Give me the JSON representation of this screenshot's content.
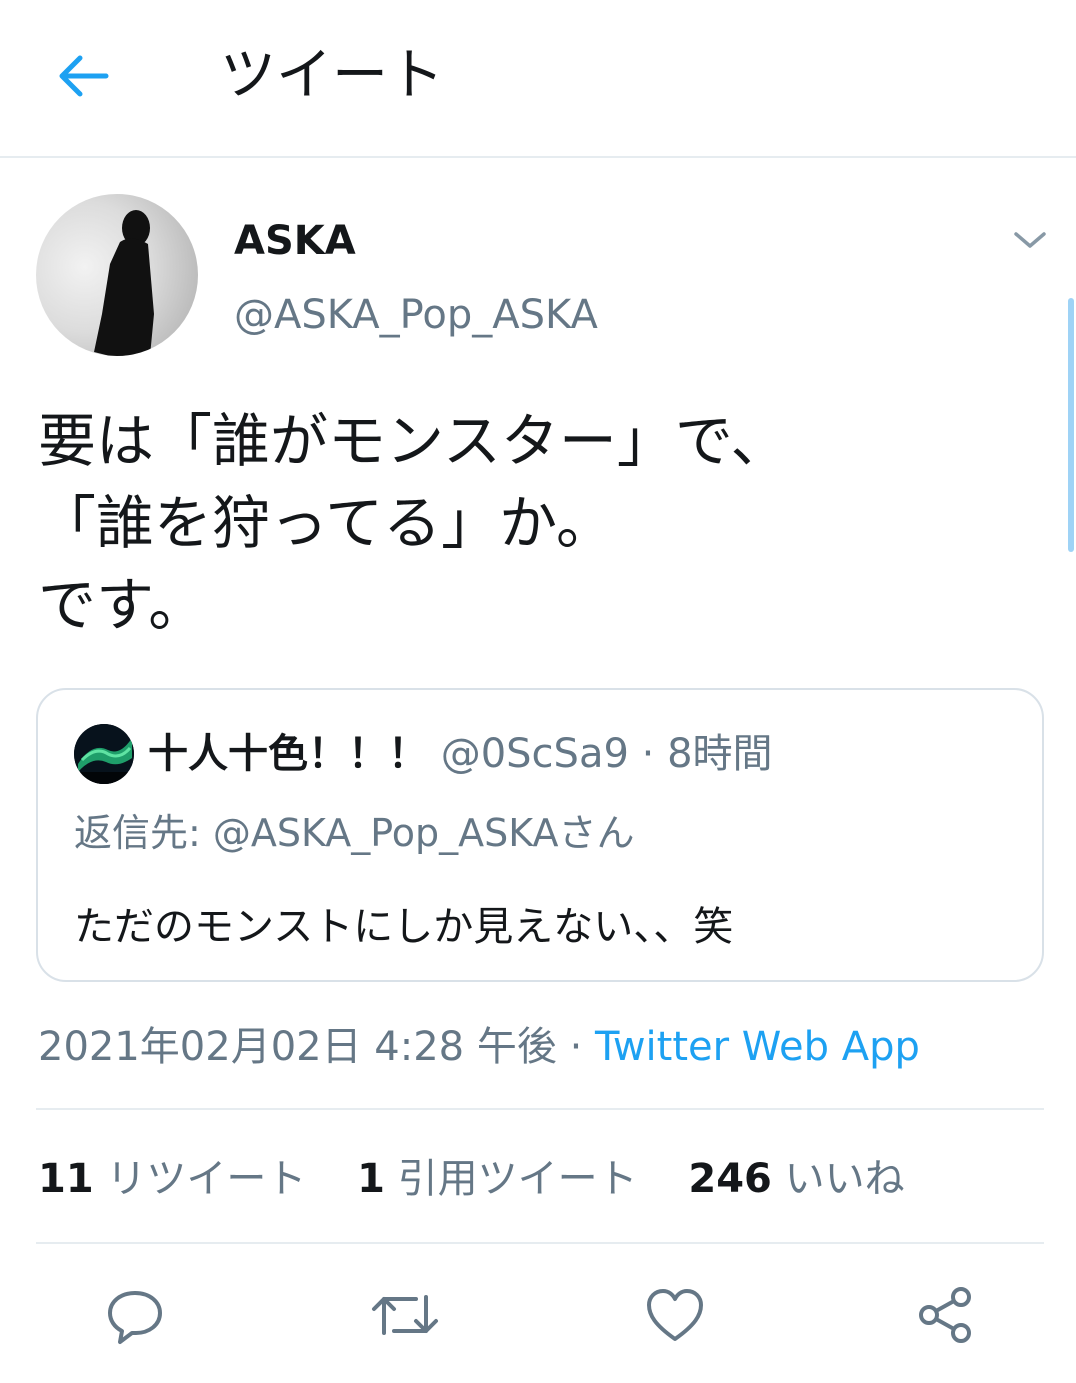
{
  "header": {
    "title": "ツイート",
    "back_icon": "arrow-left-icon",
    "accent": "#1da1f2"
  },
  "tweet": {
    "author_name": "ASKA",
    "author_handle": "@ASKA_Pop_ASKA",
    "text": "要は「誰がモンスター」で、\n「誰を狩ってる」か。\nです。",
    "timestamp": "2021年02月02日 4:28 午後",
    "separator": "·",
    "source": "Twitter Web App"
  },
  "quote": {
    "name": "十人十色！！！",
    "handle": "@0ScSa9",
    "dot": "·",
    "time": "8時間",
    "reply_to": "返信先: @ASKA_Pop_ASKAさん",
    "text": "ただのモンストにしか見えない、、笑"
  },
  "stats": {
    "retweets_count": "11",
    "retweets_label": "リツイート",
    "quotes_count": "1",
    "quotes_label": "引用ツイート",
    "likes_count": "246",
    "likes_label": "いいね"
  },
  "colors": {
    "secondary_text": "#657786",
    "border": "#e6ecf0",
    "link": "#1da1f2"
  }
}
